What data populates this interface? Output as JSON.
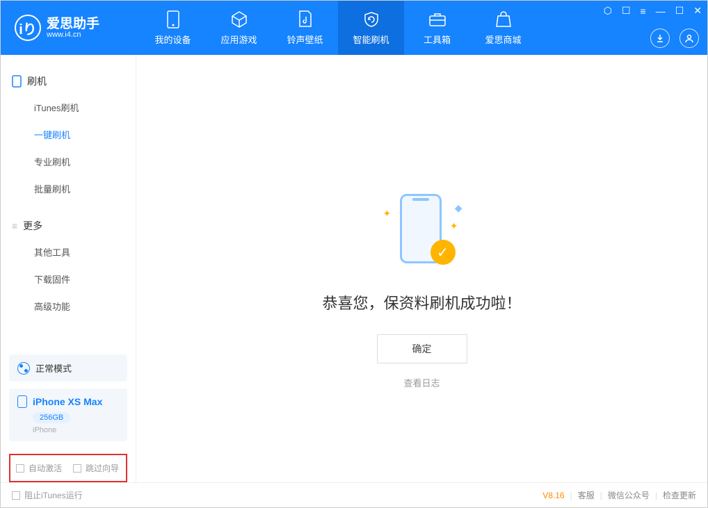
{
  "app": {
    "title": "爱思助手",
    "subtitle": "www.i4.cn"
  },
  "tabs": {
    "device": "我的设备",
    "apps": "应用游戏",
    "ringtone": "铃声壁纸",
    "flash": "智能刷机",
    "toolbox": "工具箱",
    "store": "爱思商城"
  },
  "sidebar": {
    "section1": "刷机",
    "items1": {
      "itunes": "iTunes刷机",
      "oneclick": "一键刷机",
      "pro": "专业刷机",
      "batch": "批量刷机"
    },
    "section2": "更多",
    "items2": {
      "other": "其他工具",
      "download": "下载固件",
      "advanced": "高级功能"
    }
  },
  "device": {
    "mode": "正常模式",
    "name": "iPhone XS Max",
    "storage": "256GB",
    "type": "iPhone"
  },
  "checkboxes": {
    "auto_activate": "自动激活",
    "skip_guide": "跳过向导"
  },
  "main": {
    "success": "恭喜您，保资料刷机成功啦！",
    "confirm": "确定",
    "log": "查看日志"
  },
  "footer": {
    "block_itunes": "阻止iTunes运行",
    "version": "V8.16",
    "service": "客服",
    "wechat": "微信公众号",
    "update": "检查更新"
  }
}
